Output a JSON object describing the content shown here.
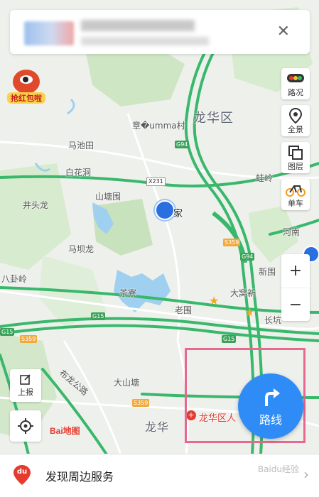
{
  "banner": {
    "close_icon": "close-icon"
  },
  "districts": {
    "longhua": "龙华区",
    "longhua_town": "龙华"
  },
  "places": {
    "zhanglangcun": "章�umma村",
    "machitian": "马池田",
    "baihuadong": "白花洞",
    "jingtoulong": "井头龙",
    "shantangwei": "山塘围",
    "home": "家",
    "majiaolong": "马坝龙",
    "chaliao": "茶寮",
    "laowei": "老围",
    "dawoxin": "大窝新",
    "xinwei": "新围",
    "changkeng": "长坑",
    "dashantang": "大山塘",
    "heshu": "河南",
    "bagualing": "八卦岭",
    "jiangbian": "蛙岭",
    "buyu": "布龙公路",
    "laowei2": "老围",
    "hospital": "龙华区人"
  },
  "shields": {
    "g94a": "G94",
    "g94b": "G94",
    "s359a": "S359",
    "s359b": "S359",
    "s359c": "S359",
    "g15a": "G15",
    "g15b": "G15",
    "g15c": "G15",
    "x231": "X231"
  },
  "right_tools": [
    {
      "label": "路况",
      "icon": "traffic-light-icon"
    },
    {
      "label": "全景",
      "icon": "panorama-pin-icon"
    },
    {
      "label": "图层",
      "icon": "layers-icon"
    },
    {
      "label": "单车",
      "icon": "bicycle-icon"
    }
  ],
  "zoom": {
    "in": "+",
    "out": "−"
  },
  "left_tools": {
    "report": "上报",
    "locate_icon": "locate-icon"
  },
  "route_button": {
    "label": "路线",
    "icon": "turn-right-arrow-icon"
  },
  "logo": {
    "text": "Bai地图",
    "sticker": "抢红包啦"
  },
  "bottom": {
    "text": "发现周边服务",
    "logo": "du",
    "chevron": "chevron-right-icon"
  },
  "watermark": "Baidu经验",
  "colors": {
    "highway": "#39b86c",
    "accent": "#2f8cf6",
    "highlight": "#e8688f",
    "brand_red": "#e63a2f"
  }
}
